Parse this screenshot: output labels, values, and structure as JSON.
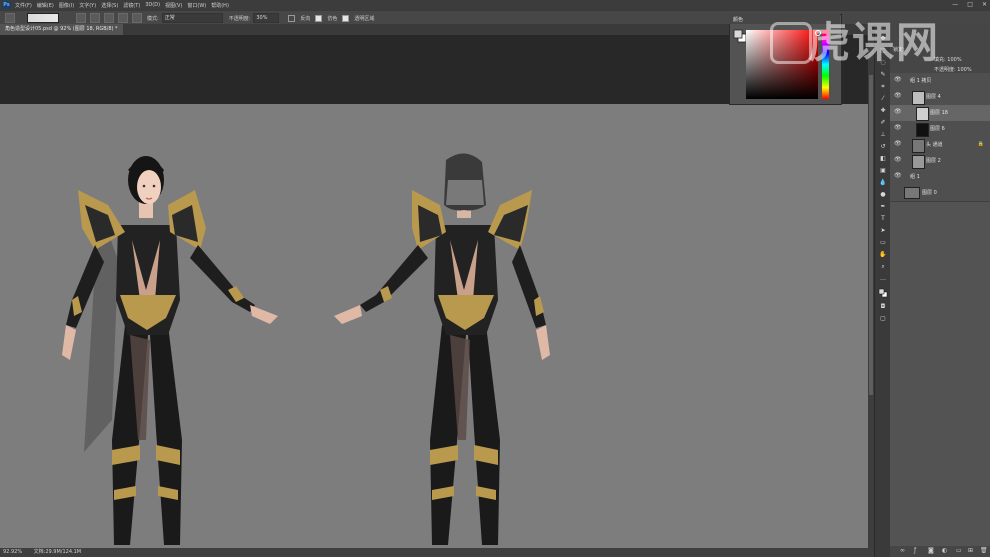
{
  "menubar": {
    "logo": "Ps",
    "items": [
      "文件(F)",
      "编辑(E)",
      "图像(I)",
      "文字(Y)",
      "选择(S)",
      "滤镜(T)",
      "3D(D)",
      "视图(V)",
      "窗口(W)",
      "帮助(H)"
    ],
    "window_buttons": [
      "—",
      "□",
      "✕"
    ]
  },
  "options": {
    "mode_label": "模式:",
    "mode_value": "正常",
    "opacity_label": "不透明度:",
    "opacity_value": "30%",
    "reverse_label": "反向",
    "dither_label": "仿色",
    "transparency_label": "透明区域"
  },
  "document": {
    "tab_title": "角色造型设计05.psd @ 92% (图层 18, RGB/8) *",
    "zoom": "92.92%",
    "status": "文档:29.9M/124.1M"
  },
  "color_panel": {
    "title": "颜色",
    "foreground": "#d9d9d9",
    "background": "#ffffff",
    "hue": "#ff0000"
  },
  "layers_panel": {
    "header_rows": [
      "锁定:",
      "填充: 100%",
      "不透明度: 100%"
    ],
    "layers": [
      {
        "name": "组 1 拷贝",
        "type": "group",
        "visible": true,
        "selected": false
      },
      {
        "name": "图层 4",
        "type": "layer",
        "visible": true,
        "selected": false
      },
      {
        "name": "图层 18",
        "type": "layer",
        "visible": true,
        "selected": true
      },
      {
        "name": "图层 6",
        "type": "layer",
        "visible": true,
        "selected": false
      },
      {
        "name": "头 通道",
        "type": "layer",
        "visible": true,
        "selected": false
      },
      {
        "name": "图层 2",
        "type": "layer",
        "visible": true,
        "selected": false
      },
      {
        "name": "组 1",
        "type": "group",
        "visible": true,
        "selected": false
      },
      {
        "name": "图层 0",
        "type": "layer",
        "visible": true,
        "selected": false
      }
    ]
  },
  "watermark": {
    "text": "虎课网"
  },
  "colors": {
    "canvas_bg": "#7d7d7d",
    "panel_bg": "#535353",
    "selected_row": "#666666",
    "armor_gold": "#b8994d"
  }
}
